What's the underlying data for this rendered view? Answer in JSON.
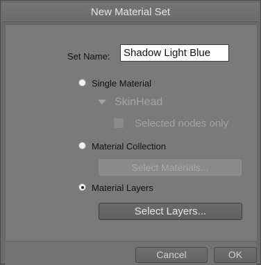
{
  "dialog": {
    "title": "New Material Set"
  },
  "set_name": {
    "label": "Set Name:",
    "value": "Shadow Light Blue"
  },
  "options": {
    "single_material": {
      "label": "Single Material",
      "selected": false,
      "dropdown_value": "SkinHead",
      "selected_nodes_only_label": "Selected nodes only",
      "selected_nodes_only_checked": false
    },
    "material_collection": {
      "label": "Material Collection",
      "selected": false,
      "button_label": "Select Materials..."
    },
    "material_layers": {
      "label": "Material Layers",
      "selected": true,
      "button_label": "Select Layers..."
    }
  },
  "footer": {
    "cancel_label": "Cancel",
    "ok_label": "OK"
  }
}
